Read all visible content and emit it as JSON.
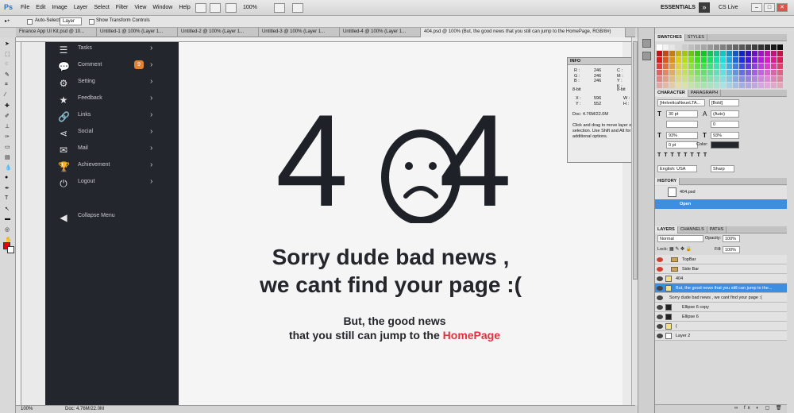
{
  "app": {
    "logo": "Ps",
    "menus": [
      "File",
      "Edit",
      "Image",
      "Layer",
      "Select",
      "Filter",
      "View",
      "Window",
      "Help"
    ],
    "zoom": "100%",
    "workspace": "ESSENTIALS",
    "cslive": "CS Live"
  },
  "options": {
    "auto_select": "Auto-Select:",
    "auto_select_value": "Layer",
    "transform": "Show Transform Controls"
  },
  "tabs": [
    "Finance App UI Kit.psd @ 10...",
    "Untitled-1 @ 100% (Layer 1...",
    "Untitled-2 @ 100% (Layer 1...",
    "Untitled-3 @ 100% (Layer 1...",
    "Untitled-4 @ 100% (Layer 1...",
    "404.psd @ 100% (But, the good news  that you still can jump to the HomePage, RGB/8#)"
  ],
  "sidebar": {
    "items": [
      {
        "icon": "menu-icon",
        "glyph": "☰",
        "label": "Tasks"
      },
      {
        "icon": "comment-icon",
        "glyph": "💬",
        "label": "Comment",
        "badge": "9"
      },
      {
        "icon": "gear-icon",
        "glyph": "⚙",
        "label": "Setting"
      },
      {
        "icon": "star-icon",
        "glyph": "★",
        "label": "Feedback"
      },
      {
        "icon": "link-icon",
        "glyph": "🔗",
        "label": "Links"
      },
      {
        "icon": "share-icon",
        "glyph": "⋖",
        "label": "Social"
      },
      {
        "icon": "mail-icon",
        "glyph": "✉",
        "label": "Mail"
      },
      {
        "icon": "trophy-icon",
        "glyph": "🏆",
        "label": "Achievement"
      },
      {
        "icon": "power-icon",
        "glyph": "⏻",
        "label": "Logout"
      }
    ],
    "collapse": {
      "icon": "chevron-left-circle-icon",
      "glyph": "◀",
      "label": "Collapse Menu"
    }
  },
  "page": {
    "code_a": "4",
    "code_b": "4",
    "sorry_line1": "Sorry dude bad news ,",
    "sorry_line2": "we cant find your page :(",
    "good_line1": "But, the good news",
    "good_line2_prefix": "that you still can jump to the ",
    "homepage_link": "HomePage",
    "accent": "#e0323e"
  },
  "info": {
    "title": "INFO",
    "rgb": [
      "R :",
      "G :",
      "B :"
    ],
    "rgb_vals": [
      "246",
      "246",
      "246"
    ],
    "cmyk": [
      "C :",
      "M :",
      "Y :",
      "K :"
    ],
    "cmyk_vals": [
      "4%",
      "3%",
      "3%",
      "0%"
    ],
    "bit1": "8-bit",
    "bit2": "8-bit",
    "x": "X :",
    "x_val": "596",
    "y": "Y :",
    "y_val": "552",
    "w": "W :",
    "h": "H :",
    "doc": "Doc: 4.76M/22.0M",
    "hint": "Click and drag to move layer or selection.  Use Shift and Alt for additional options."
  },
  "panels": {
    "swatches_tab": "SWATCHES",
    "styles_tab": "STYLES",
    "character_tab": "CHARACTER",
    "paragraph_tab": "PARAGRAPH",
    "font": "[HelveticaNeueLTA...",
    "style": "[Bold]",
    "size": "30 pt",
    "leading": "(Auto)",
    "tracking": "0",
    "vscale": "93%",
    "hscale": "93%",
    "baseline": "0 pt",
    "color_label": "Color:",
    "language": "English: USA",
    "aa": "Sharp",
    "history_tab": "HISTORY",
    "history_items": [
      "404.psd",
      "Open"
    ],
    "layers_tab": "LAYERS",
    "channels_tab": "CHANNELS",
    "paths_tab": "PATHS",
    "blend": "Normal",
    "opacity_label": "Opacity:",
    "opacity": "100%",
    "lock_label": "Lock:",
    "fill_label": "Fill:",
    "fill": "100%",
    "layers": [
      "TopBar",
      "Side Bar",
      "404",
      "But, the good news  that you still can jump to the...",
      "Sorry dude bad news ,  we cant find your page :(",
      "Ellipse 6 copy",
      "Ellipse 6",
      "(",
      "Layer 2"
    ]
  },
  "status": {
    "zoom": "100%",
    "doc": "Doc: 4.76M/22.0M"
  }
}
